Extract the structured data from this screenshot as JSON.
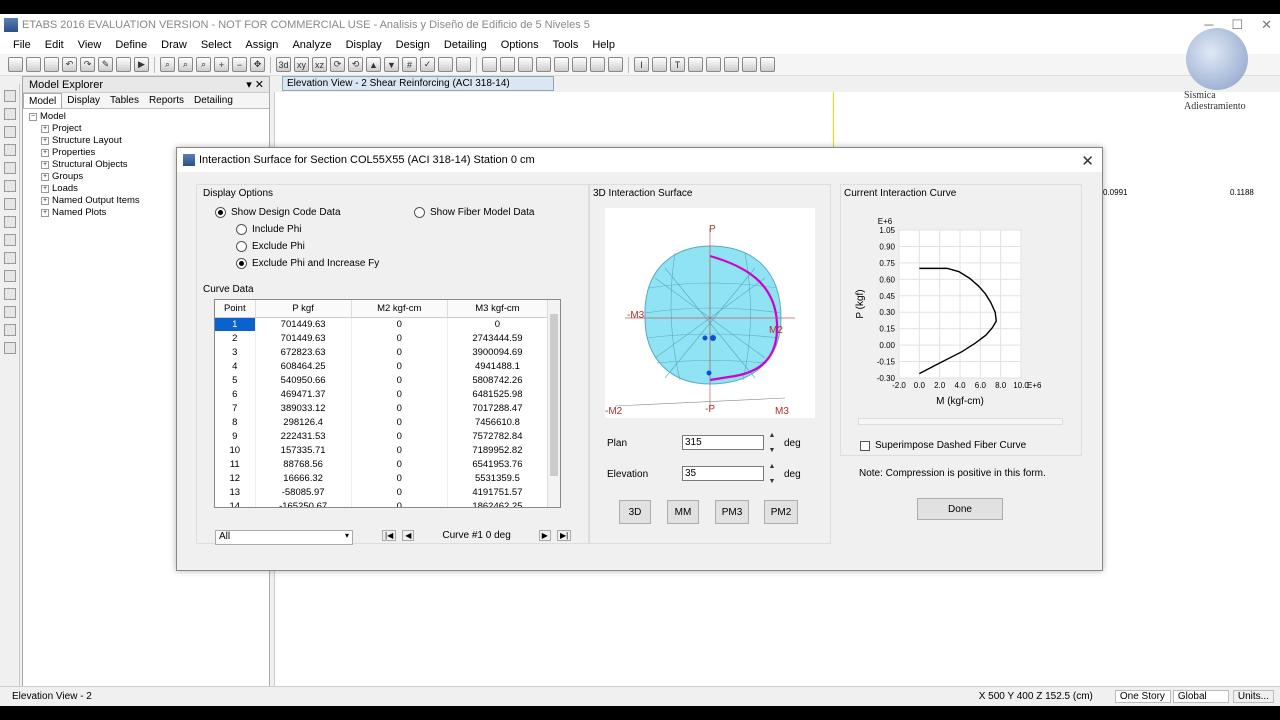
{
  "app": {
    "title": "ETABS 2016 EVALUATION VERSION - NOT FOR COMMERCIAL USE - Analisis y Diseño de Edificio de 5 Niveles 5"
  },
  "menu": [
    "File",
    "Edit",
    "View",
    "Define",
    "Draw",
    "Select",
    "Assign",
    "Analyze",
    "Display",
    "Design",
    "Detailing",
    "Options",
    "Tools",
    "Help"
  ],
  "explorer": {
    "title": "Model Explorer",
    "tabs": [
      "Model",
      "Display",
      "Tables",
      "Reports",
      "Detailing"
    ],
    "root": "Model",
    "items": [
      "Project",
      "Structure Layout",
      "Properties",
      "Structural Objects",
      "Groups",
      "Loads",
      "Named Output Items",
      "Named Plots"
    ]
  },
  "doc_tab": "Elevation View - 2  Shear Reinforcing  (ACI 318-14)",
  "canvas_values": [
    "0.0991",
    "0.1188"
  ],
  "logo_text": [
    "Sísmica",
    "Adiestramiento"
  ],
  "status": {
    "left": "Elevation View - 2",
    "coords": "X 500  Y 400  Z 152.5 (cm)",
    "story": "One Story",
    "system": "Global",
    "units": "Units..."
  },
  "dialog": {
    "title": "Interaction Surface for Section COL55X55 (ACI 318-14)  Station 0 cm",
    "display_options": {
      "title": "Display Options",
      "design_code": "Show Design Code Data",
      "fiber": "Show Fiber Model Data",
      "include_phi": "Include Phi",
      "exclude_phi": "Exclude Phi",
      "exclude_phi_fy": "Exclude Phi and Increase Fy"
    },
    "curve_data": {
      "title": "Curve Data",
      "headers": [
        "Point",
        "P  kgf",
        "M2  kgf-cm",
        "M3  kgf-cm"
      ],
      "rows": [
        [
          "1",
          "701449.63",
          "0",
          "0"
        ],
        [
          "2",
          "701449.63",
          "0",
          "2743444.59"
        ],
        [
          "3",
          "672823.63",
          "0",
          "3900094.69"
        ],
        [
          "4",
          "608464.25",
          "0",
          "4941488.1"
        ],
        [
          "5",
          "540950.66",
          "0",
          "5808742.26"
        ],
        [
          "6",
          "469471.37",
          "0",
          "6481525.98"
        ],
        [
          "7",
          "389033.12",
          "0",
          "7017288.47"
        ],
        [
          "8",
          "298126.4",
          "0",
          "7456610.8"
        ],
        [
          "9",
          "222431.53",
          "0",
          "7572782.84"
        ],
        [
          "10",
          "157335.71",
          "0",
          "7189952.82"
        ],
        [
          "11",
          "88768.56",
          "0",
          "6541953.76"
        ],
        [
          "12",
          "16666.32",
          "0",
          "5531359.5"
        ],
        [
          "13",
          "-58085.97",
          "0",
          "4191751.57"
        ],
        [
          "14",
          "-165250.67",
          "0",
          "1862462.25"
        ]
      ],
      "filter": "All",
      "curve_label": "Curve #1  0 deg"
    },
    "surface": {
      "title": "3D Interaction Surface",
      "labels": {
        "p": "P",
        "np": "-P",
        "m2": "M2",
        "nm2": "-M2",
        "m3": "M3",
        "nm3": "-M3"
      },
      "plan_label": "Plan",
      "plan_value": "315",
      "elev_label": "Elevation",
      "elev_value": "35",
      "unit": "deg",
      "buttons": [
        "3D",
        "MM",
        "PM3",
        "PM2"
      ]
    },
    "curve": {
      "title": "Current Interaction Curve",
      "superimpose": "Superimpose Dashed Fiber Curve",
      "note": "Note:  Compression is positive in this form.",
      "done": "Done"
    }
  },
  "chart_data": {
    "type": "line",
    "xlabel": "M (kgf-cm)",
    "ylabel": "P (kgf)",
    "x_scale_label": "E+6",
    "y_scale_label": "E+6",
    "xlim": [
      -2.0,
      10.0
    ],
    "ylim": [
      -0.3,
      1.05
    ],
    "x_ticks": [
      "-2.0",
      "0.0",
      "2.0",
      "4.0",
      "6.0",
      "8.0",
      "10.0"
    ],
    "y_ticks": [
      "1.05",
      "0.90",
      "0.75",
      "0.60",
      "0.45",
      "0.30",
      "0.15",
      "0.00",
      "-0.15",
      "-0.30"
    ],
    "grid": true,
    "series": [
      {
        "x": [
          0,
          2.74,
          3.9,
          4.94,
          5.81,
          6.48,
          7.02,
          7.46,
          7.57,
          7.19,
          6.54,
          5.53,
          4.19,
          1.86,
          0
        ],
        "y": [
          0.7,
          0.7,
          0.67,
          0.61,
          0.54,
          0.47,
          0.39,
          0.3,
          0.22,
          0.16,
          0.09,
          0.02,
          -0.06,
          -0.17,
          -0.26
        ]
      }
    ]
  }
}
